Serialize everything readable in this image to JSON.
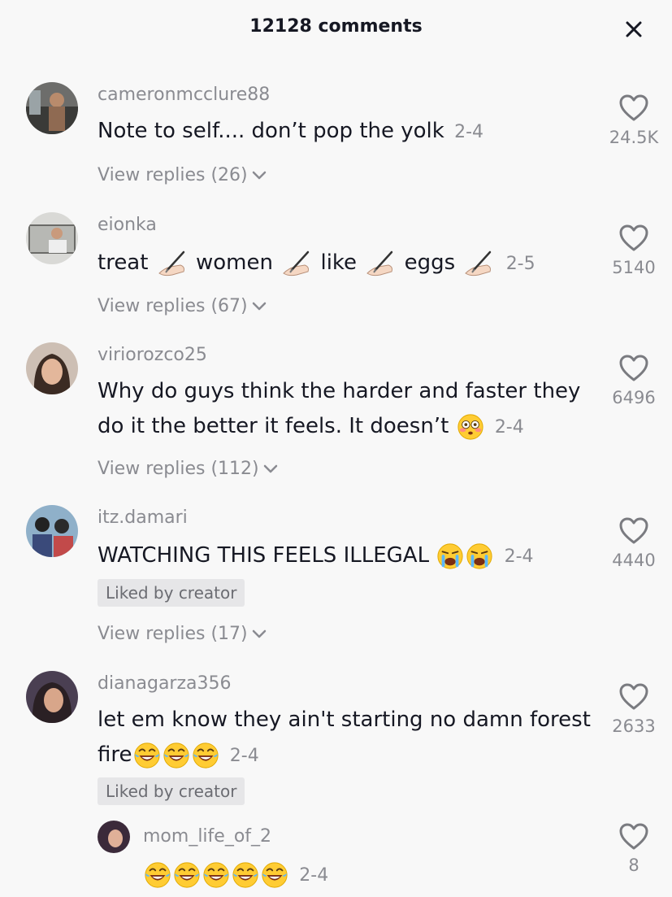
{
  "header": {
    "title": "12128 comments",
    "close_icon": "close-icon"
  },
  "comments": [
    {
      "username": "cameronmcclure88",
      "text": "Note to self.... don’t pop the yolk",
      "date": "2-4",
      "likes": "24.5K",
      "view_replies": "View replies (26)"
    },
    {
      "username": "eionka",
      "text_parts": [
        "treat",
        "women",
        "like",
        "eggs"
      ],
      "emoji": "writing-hand",
      "date": "2-5",
      "likes": "5140",
      "view_replies": "View replies (67)"
    },
    {
      "username": "viriorozco25",
      "text_line1": "Why do guys think the harder and faster they",
      "text_line2": "do it the better it feels. It doesn’t",
      "emoji": "flushed-face",
      "date": "2-4",
      "likes": "6496",
      "view_replies": "View replies (112)"
    },
    {
      "username": "itz.damari",
      "text": "WATCHING THIS FEELS ILLEGAL",
      "emoji": "loudly-crying-face",
      "date": "2-4",
      "likes": "4440",
      "badge": "Liked by creator",
      "view_replies": "View replies (17)"
    },
    {
      "username": "dianagarza356",
      "text_line1": "let em know they ain't starting no damn forest",
      "text_line2": "fire",
      "emoji": "face-with-tears-of-joy",
      "date": "2-4",
      "likes": "2633",
      "badge": "Liked by creator"
    },
    {
      "username": "mom_life_of_2",
      "emoji": "face-with-tears-of-joy",
      "date": "2-4",
      "likes": "8",
      "is_reply": true
    }
  ],
  "colors": {
    "background": "#f8f8f8",
    "primary_text": "#161823",
    "secondary_text": "#8a8b91",
    "badge_bg": "#e6e6e8"
  }
}
